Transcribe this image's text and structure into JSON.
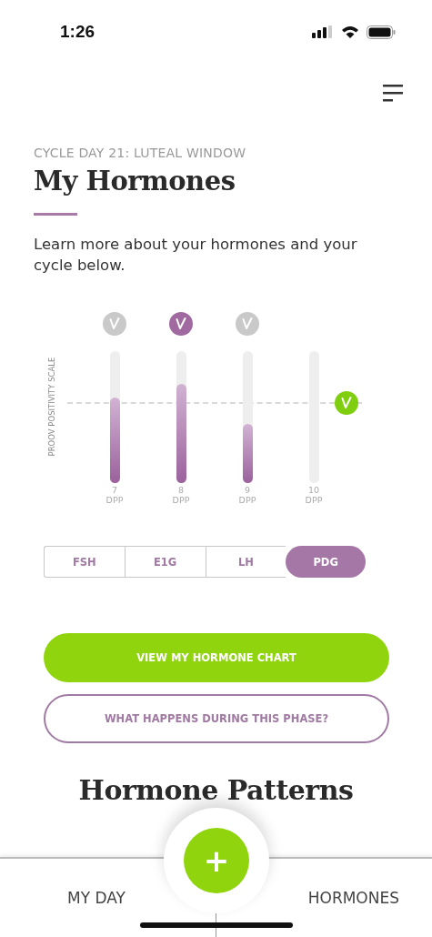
{
  "status_bar": {
    "time": "1:26"
  },
  "eyebrow": "CYCLE DAY 21: LUTEAL WINDOW",
  "title": "My Hormones",
  "intro": "Learn more about your hormones and your cycle below.",
  "chart": {
    "axis_label": "PROOV POSITIVITY SCALE",
    "days": [
      {
        "day": "7",
        "unit": "DPP",
        "level": 0.65,
        "color": "#c9c9c9"
      },
      {
        "day": "8",
        "unit": "DPP",
        "level": 0.75,
        "color": "#a06aa0"
      },
      {
        "day": "9",
        "unit": "DPP",
        "level": 0.45,
        "color": "#c9c9c9"
      },
      {
        "day": "10",
        "unit": "DPP"
      }
    ]
  },
  "tabs": [
    {
      "label": "FSH",
      "selected": false
    },
    {
      "label": "E1G",
      "selected": false
    },
    {
      "label": "LH",
      "selected": false
    },
    {
      "label": "PDG",
      "selected": true
    }
  ],
  "primary_button": "VIEW MY HORMONE CHART",
  "secondary_button": "WHAT HAPPENS DURING THIS PHASE?",
  "section_title": "Hormone Patterns",
  "bottom_nav": [
    {
      "label": "MY DAY"
    },
    {
      "label": "HORMONES"
    }
  ],
  "fab": "+"
}
